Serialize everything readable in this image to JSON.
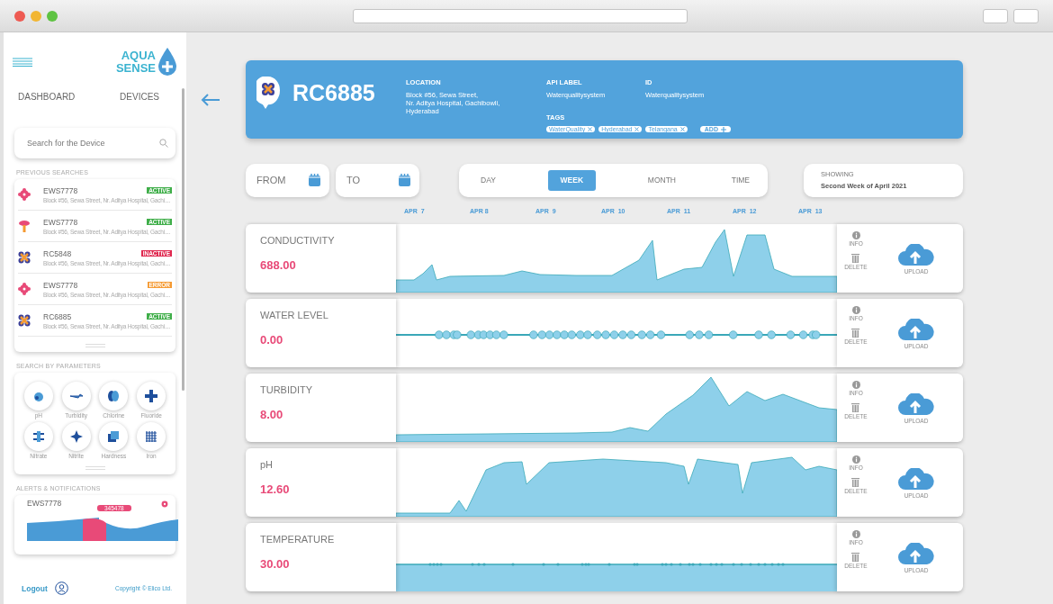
{
  "sidebar": {
    "logo": {
      "line1": "AQUA",
      "line2": "SENSE"
    },
    "nav": [
      {
        "label": "DASHBOARD",
        "selected": false
      },
      {
        "label": "DEVICES",
        "selected": false
      }
    ],
    "search": {
      "placeholder": "Search for the Device"
    },
    "previous_searches_title": "PREVIOUS SEARCHES",
    "previous_searches": [
      {
        "kind": "flower",
        "name": "EWS7778",
        "status": "ACTIVE",
        "color": "#3fae49",
        "address": "Block #56, Sewa Street, Nr. Aditya Hospital, Gachi...."
      },
      {
        "kind": "probe",
        "name": "EWS7778",
        "status": "ACTIVE",
        "color": "#3fae49",
        "address": "Block #56, Sewa Street, Nr. Aditya Hospital, Gachi...."
      },
      {
        "kind": "cross",
        "name": "RC5848",
        "status": "INACTIVE",
        "color": "#e0284f",
        "address": "Block #56, Sewa Street, Nr. Aditya Hospital, Gachi...."
      },
      {
        "kind": "flower",
        "name": "EWS7778",
        "status": "ERROR",
        "color": "#f59a32",
        "address": "Block #56, Sewa Street, Nr. Aditya Hospital, Gachi...."
      },
      {
        "kind": "cross",
        "name": "RC6885",
        "status": "ACTIVE",
        "color": "#3fae49",
        "address": "Block #56, Sewa Street, Nr. Aditya Hospital, Gachi...."
      }
    ],
    "parameters_title": "SEARCH BY PARAMETERS",
    "parameters": [
      {
        "kind": "drop",
        "label": "pH"
      },
      {
        "kind": "plane",
        "label": "Turbidity"
      },
      {
        "kind": "pill",
        "label": "Chlorine"
      },
      {
        "kind": "plus",
        "label": "Fluoride"
      },
      {
        "kind": "bars",
        "label": "Nitrate"
      },
      {
        "kind": "star",
        "label": "Nitrite"
      },
      {
        "kind": "squares",
        "label": "Hardness"
      },
      {
        "kind": "grid",
        "label": "Iron"
      }
    ],
    "alerts_title": "ALERTS & NOTIFICATIONS",
    "alert": {
      "name": "EWS7778",
      "value": "345478"
    },
    "logout": "Logout",
    "copyright": "Copyright © Elico Ltd."
  },
  "device": {
    "name": "RC6885",
    "location_label": "LOCATION",
    "location": "Block #56, Sewa Street,\nNr. Aditya Hospital, Gachibowli,\nHyderabad",
    "api_label_label": "API LABEL",
    "api_label": "Waterqualitysystem",
    "id_label": "ID",
    "id": "Waterqualitysystem",
    "tags_label": "TAGS",
    "tags": [
      "WaterQuality",
      "Hyderabad",
      "Telangana"
    ],
    "add_label": "ADD"
  },
  "filters": {
    "from": "FROM",
    "to": "TO",
    "periods": [
      {
        "label": "DAY",
        "selected": false
      },
      {
        "label": "WEEK",
        "selected": true
      },
      {
        "label": "MONTH",
        "selected": false
      },
      {
        "label": "TIME",
        "selected": false
      }
    ],
    "showing_label": "SHOWING",
    "showing": "Second Week of April 2021"
  },
  "dates": [
    "APR  7",
    "APR 8",
    "APR  9",
    "APR  10",
    "APR  11",
    "APR  12",
    "APR  13"
  ],
  "readings": [
    {
      "kind": "area",
      "name": "CONDUCTIVITY",
      "value": "688.00",
      "info": "INFO",
      "delete": "DELETE",
      "upload": "UPLOAD"
    },
    {
      "kind": "dots",
      "name": "WATER LEVEL",
      "value": "0.00",
      "info": "INFO",
      "delete": "DELETE",
      "upload": "UPLOAD"
    },
    {
      "kind": "area",
      "name": "TURBIDITY",
      "value": "8.00",
      "info": "INFO",
      "delete": "DELETE",
      "upload": "UPLOAD"
    },
    {
      "kind": "area",
      "name": "pH",
      "value": "12.60",
      "info": "INFO",
      "delete": "DELETE",
      "upload": "UPLOAD"
    },
    {
      "kind": "dotband",
      "name": "TEMPERATURE",
      "value": "30.00",
      "info": "INFO",
      "delete": "DELETE",
      "upload": "UPLOAD"
    }
  ]
}
